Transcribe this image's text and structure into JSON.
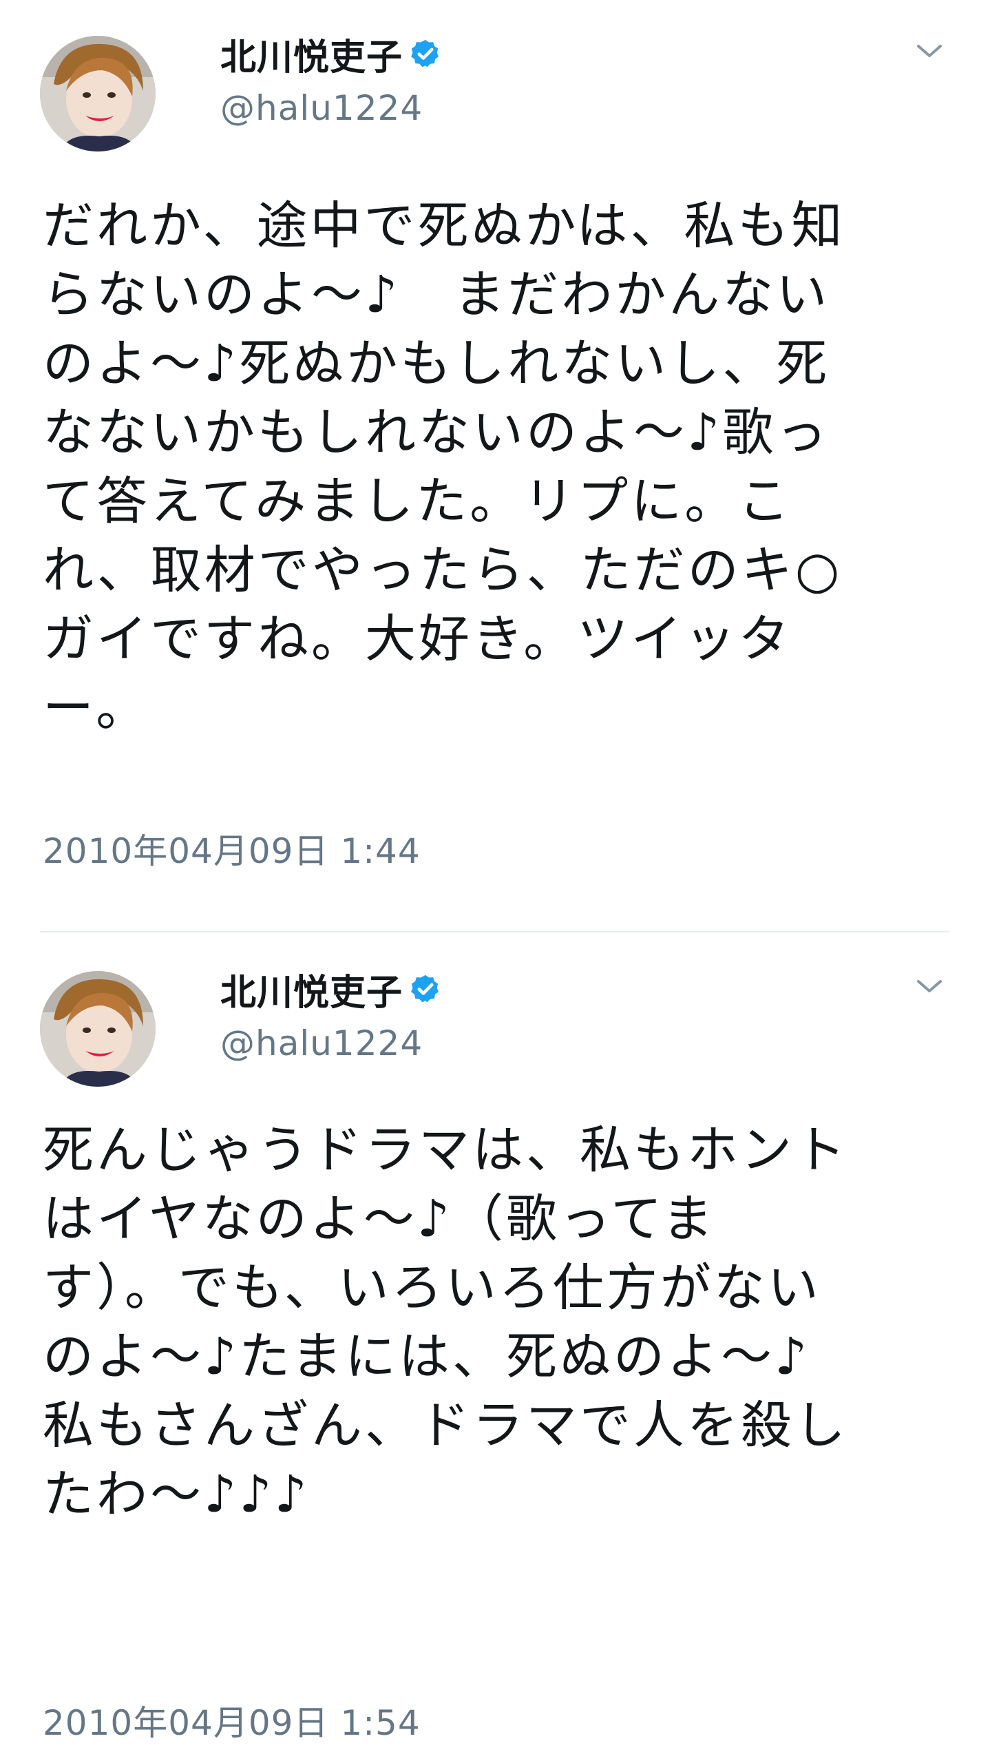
{
  "colors": {
    "text": "#14171a",
    "secondary": "#657786",
    "verified": "#1da1f2",
    "divider": "#e6ecf0"
  },
  "tweets": [
    {
      "display_name": "北川悦吏子",
      "verified_icon": "verified-badge-icon",
      "handle": "@halu1224",
      "text": "だれか、途中で死ぬかは、私も知\nらないのよ～♪　まだわかんない\nのよ～♪死ぬかもしれないし、死\nなないかもしれないのよ～♪歌っ\nて答えてみました。リプに。こ\nれ、取材でやったら、ただのキ○\nガイですね。大好き。ツイッタ\nー。",
      "timestamp": "2010年04月09日 1:44",
      "menu_icon": "chevron-down-icon"
    },
    {
      "display_name": "北川悦吏子",
      "verified_icon": "verified-badge-icon",
      "handle": "@halu1224",
      "text": "死んじゃうドラマは、私もホント\nはイヤなのよ～♪（歌ってま\nす）。でも、いろいろ仕方がない\nのよ～♪たまには、死ぬのよ～♪\n私もさんざん、ドラマで人を殺し\nたわ～♪♪♪",
      "timestamp": "2010年04月09日 1:54",
      "menu_icon": "chevron-down-icon"
    }
  ]
}
